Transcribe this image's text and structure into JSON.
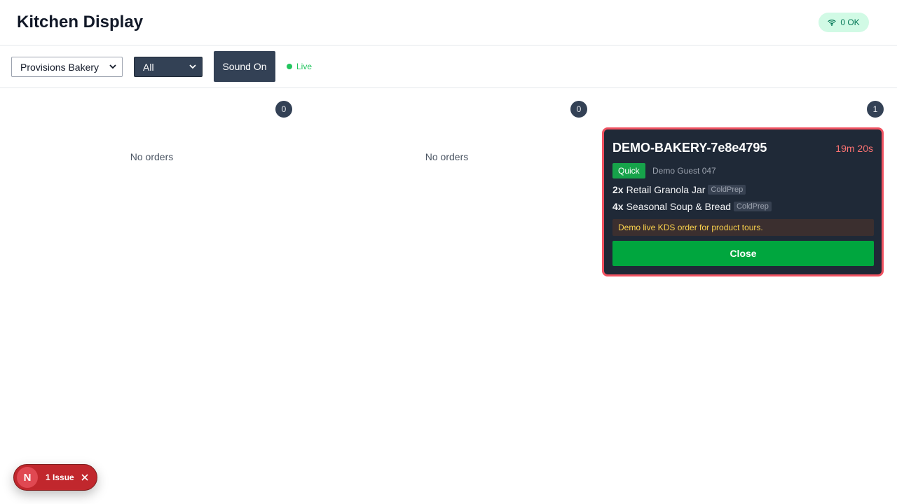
{
  "header": {
    "title": "Kitchen Display",
    "connection_badge": "0 OK",
    "connection_icon": "wifi-icon"
  },
  "toolbar": {
    "store_select_value": "Provisions Bakery",
    "filter_select_value": "All",
    "sound_button_label": "Sound On",
    "live_label": "Live"
  },
  "columns": [
    {
      "count": "0",
      "empty_text": "No orders"
    },
    {
      "count": "0",
      "empty_text": "No orders"
    },
    {
      "count": "1"
    }
  ],
  "order": {
    "id": "DEMO-BAKERY-7e8e4795",
    "timer": "19m 20s",
    "type_badge": "Quick",
    "guest": "Demo Guest 047",
    "items": [
      {
        "qty": "2x",
        "name": "Retail Granola Jar",
        "station": "ColdPrep"
      },
      {
        "qty": "4x",
        "name": "Seasonal Soup & Bread",
        "station": "ColdPrep"
      }
    ],
    "note": "Demo live KDS order for product tours.",
    "close_label": "Close"
  },
  "dev_overlay": {
    "logo_letter": "N",
    "issue_label": "1 Issue"
  },
  "colors": {
    "card_bg": "#1f2937",
    "card_border": "#f05261",
    "close_button": "#00a63e",
    "live": "#22c55e",
    "badge_ok_bg": "#d1fae5"
  }
}
